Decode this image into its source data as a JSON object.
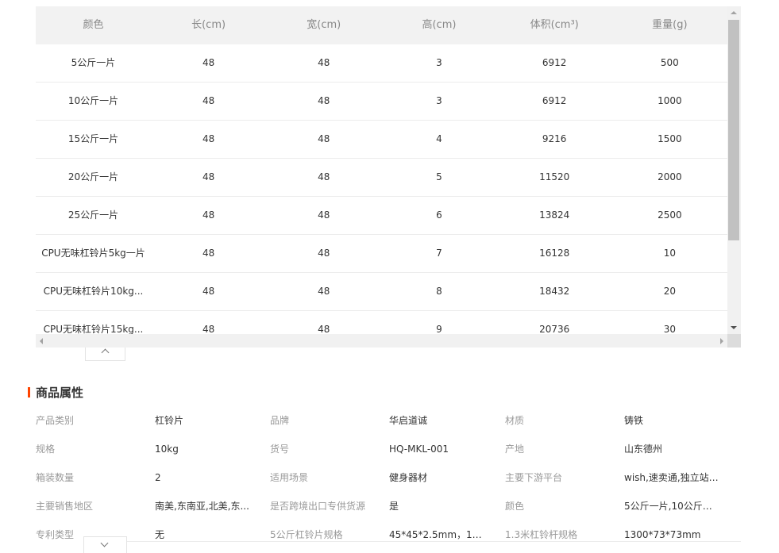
{
  "sku_table": {
    "headers": [
      "颜色",
      "长(cm)",
      "宽(cm)",
      "高(cm)",
      "体积(cm³)",
      "重量(g)"
    ],
    "rows": [
      [
        "5公斤一片",
        "48",
        "48",
        "3",
        "6912",
        "500"
      ],
      [
        "10公斤一片",
        "48",
        "48",
        "3",
        "6912",
        "1000"
      ],
      [
        "15公斤一片",
        "48",
        "48",
        "4",
        "9216",
        "1500"
      ],
      [
        "20公斤一片",
        "48",
        "48",
        "5",
        "11520",
        "2000"
      ],
      [
        "25公斤一片",
        "48",
        "48",
        "6",
        "13824",
        "2500"
      ],
      [
        "CPU无味杠铃片5kg一片",
        "48",
        "48",
        "7",
        "16128",
        "10"
      ],
      [
        "CPU无味杠铃片10kg...",
        "48",
        "48",
        "8",
        "18432",
        "20"
      ],
      [
        "CPU无味杠铃片15kg...",
        "48",
        "48",
        "9",
        "20736",
        "30"
      ]
    ]
  },
  "section": {
    "title": "商品属性",
    "accent_color": "#ff4400"
  },
  "attributes": [
    [
      [
        "产品类别",
        "杠铃片"
      ],
      [
        "品牌",
        "华启道诚"
      ],
      [
        "材质",
        "铸铁"
      ]
    ],
    [
      [
        "规格",
        "10kg"
      ],
      [
        "货号",
        "HQ-MKL-001"
      ],
      [
        "产地",
        "山东德州"
      ]
    ],
    [
      [
        "箱装数量",
        "2"
      ],
      [
        "适用场景",
        "健身器材"
      ],
      [
        "主要下游平台",
        "wish,速卖通,独立站,L..."
      ]
    ],
    [
      [
        "主要销售地区",
        "南美,东南亚,北美,东..."
      ],
      [
        "是否跨境出口专供货源",
        "是"
      ],
      [
        "颜色",
        "5公斤一片,10公斤一..."
      ]
    ],
    [
      [
        "专利类型",
        "无"
      ],
      [
        "5公斤杠铃片规格",
        "45*45*2.5mm，10公..."
      ],
      [
        "1.3米杠铃杆规格",
        "1300*73*73mm"
      ]
    ]
  ],
  "icons": {
    "collapse_up": "chevron-up-icon",
    "expand_down": "chevron-down-icon"
  }
}
